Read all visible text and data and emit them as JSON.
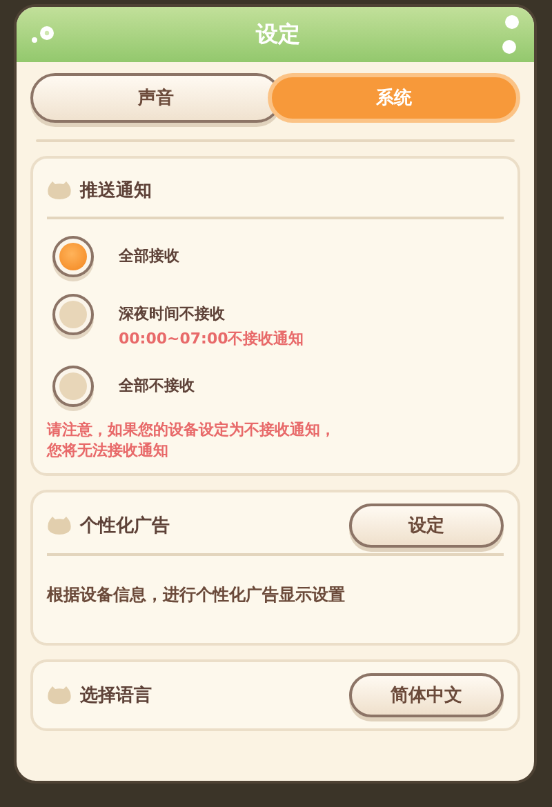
{
  "window": {
    "title": "设定"
  },
  "tabs": [
    {
      "label": "声音",
      "selected": false
    },
    {
      "label": "系统",
      "selected": true
    }
  ],
  "sections": [
    {
      "kind": "radio",
      "title": "推送通知",
      "options": [
        {
          "label": "全部接收",
          "selected": true
        },
        {
          "label": "深夜时间不接收",
          "note": "00:00~07:00不接收通知",
          "selected": false
        },
        {
          "label": "全部不接收",
          "selected": false
        }
      ],
      "warning": "请注意，如果您的设备设定为不接收通知，您将无法接收通知"
    },
    {
      "kind": "button",
      "title": "个性化广告",
      "button": "设定",
      "description": "根据设备信息，进行个性化广告显示设置"
    },
    {
      "kind": "button",
      "title": "选择语言",
      "button": "简体中文"
    }
  ]
}
